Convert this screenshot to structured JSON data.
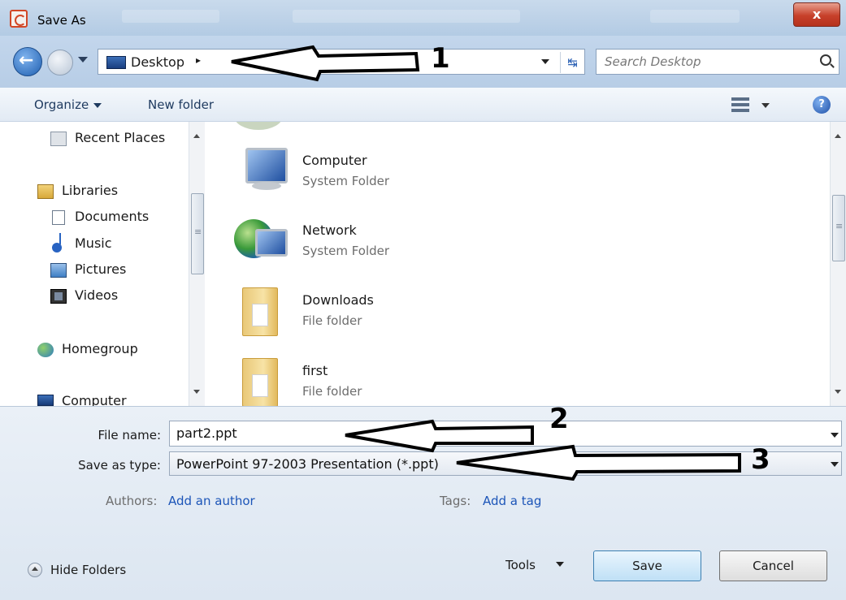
{
  "window": {
    "title": "Save As",
    "close_label": "x"
  },
  "address": {
    "location": "Desktop",
    "separator": "▸",
    "refresh_glyph": "↹",
    "search_placeholder": "Search Desktop"
  },
  "toolbar": {
    "organize_label": "Organize",
    "new_folder_label": "New folder",
    "help_glyph": "?"
  },
  "nav": {
    "items": [
      {
        "label": "Recent Places",
        "icon": "recent-places-icon"
      },
      {
        "label": "Libraries",
        "icon": "libraries-icon"
      },
      {
        "label": "Documents",
        "icon": "documents-icon"
      },
      {
        "label": "Music",
        "icon": "music-icon"
      },
      {
        "label": "Pictures",
        "icon": "pictures-icon"
      },
      {
        "label": "Videos",
        "icon": "videos-icon"
      },
      {
        "label": "Homegroup",
        "icon": "homegroup-icon"
      },
      {
        "label": "Computer",
        "icon": "computer-icon"
      }
    ]
  },
  "files": [
    {
      "name": "Computer",
      "type": "System Folder",
      "icon": "computer-icon"
    },
    {
      "name": "Network",
      "type": "System Folder",
      "icon": "network-icon"
    },
    {
      "name": "Downloads",
      "type": "File folder",
      "icon": "folder-icon"
    },
    {
      "name": "first",
      "type": "File folder",
      "icon": "folder-icon"
    }
  ],
  "form": {
    "file_name_label": "File name:",
    "file_name_value": "part2.ppt",
    "save_type_label": "Save as type:",
    "save_type_value": "PowerPoint 97-2003 Presentation (*.ppt)",
    "authors_label": "Authors:",
    "authors_link": "Add an author",
    "tags_label": "Tags:",
    "tags_link": "Add a tag"
  },
  "footer": {
    "hide_folders_label": "Hide Folders",
    "tools_label": "Tools",
    "save_label": "Save",
    "cancel_label": "Cancel"
  },
  "annotations": {
    "arrow_1_number": "1",
    "arrow_2_number": "2",
    "arrow_3_number": "3"
  },
  "colors": {
    "link": "#1c55b8",
    "title_gradient_top": "#c9daec",
    "close_button": "#c7402a"
  }
}
